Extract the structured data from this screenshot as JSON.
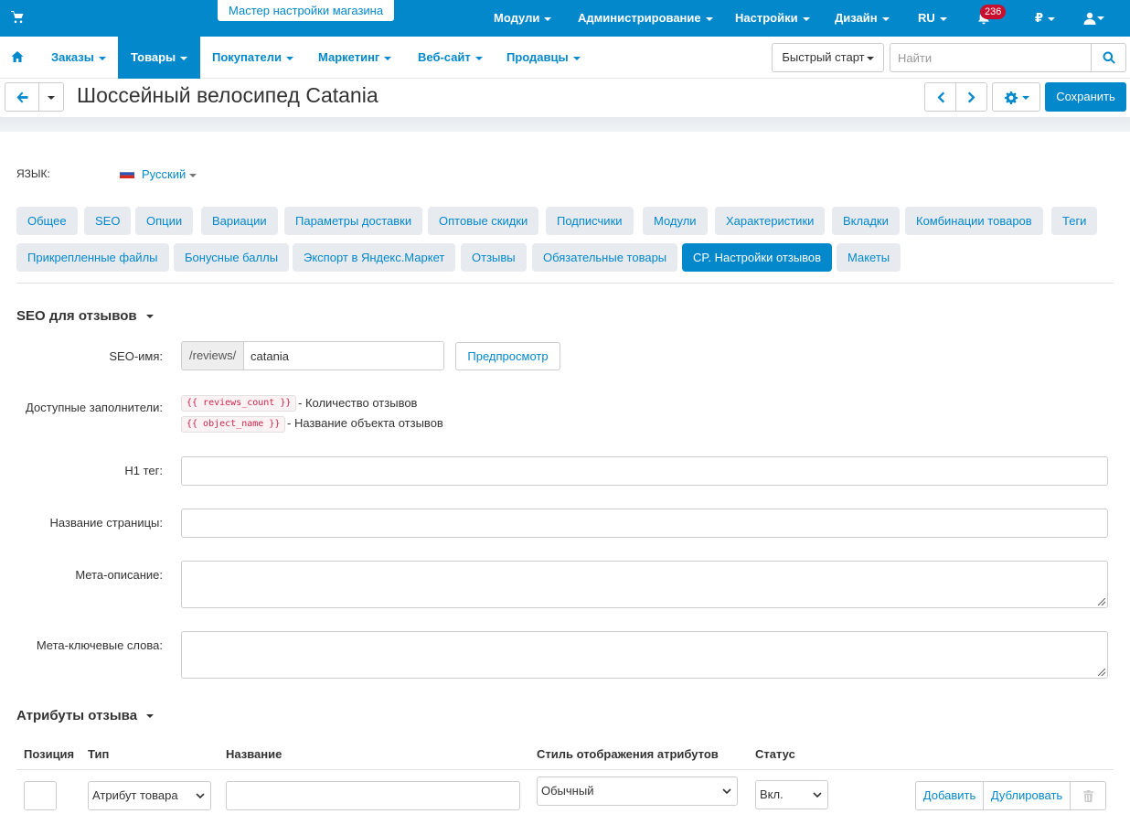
{
  "topbar": {
    "wizard_tab": "Мастер настройки магазина",
    "menu": [
      "Модули",
      "Администрирование",
      "Настройки",
      "Дизайн",
      "RU"
    ],
    "notifications_count": "236",
    "currency": "₽",
    "bg_color": "#0388cc"
  },
  "navbar": {
    "items": [
      "Заказы",
      "Товары",
      "Покупатели",
      "Маркетинг",
      "Веб-сайт",
      "Продавцы"
    ],
    "active": "Товары",
    "quick_start": "Быстрый старт",
    "search_placeholder": "Найти"
  },
  "titlebar": {
    "title": "Шоссейный велосипед Catania",
    "save_label": "Сохранить"
  },
  "language": {
    "label": "ЯЗЫК:",
    "value": "Русский"
  },
  "tabs": [
    "Общее",
    "SEO",
    "Опции",
    "Вариации",
    "Параметры доставки",
    "Оптовые скидки",
    "Подписчики",
    "Модули",
    "Характеристики",
    "Вкладки",
    "Комбинации товаров",
    "Теги",
    "Прикрепленные файлы",
    "Бонусные баллы",
    "Экспорт в Яндекс.Маркет",
    "Отзывы",
    "Обязательные товары",
    "CP. Настройки отзывов",
    "Макеты"
  ],
  "active_tab": "CP. Настройки отзывов",
  "seo_section": {
    "title": "SEO для отзывов",
    "seo_name_label": "SEO-имя:",
    "seo_prefix": "/reviews/",
    "seo_name_value": "catania",
    "preview_label": "Предпросмотр",
    "placeholders_label": "Доступные заполнители:",
    "placeholders": [
      {
        "code": "{{ reviews_count }}",
        "desc": "- Количество отзывов"
      },
      {
        "code": "{{ object_name }}",
        "desc": "- Название объекта отзывов"
      }
    ],
    "h1_label": "H1 тег:",
    "page_title_label": "Название страницы:",
    "meta_desc_label": "Мета-описание:",
    "meta_keywords_label": "Мета-ключевые слова:"
  },
  "attributes_section": {
    "title": "Атрибуты отзыва",
    "columns": [
      "Позиция",
      "Тип",
      "Название",
      "Стиль отображения атрибутов",
      "Статус"
    ],
    "row": {
      "type": "Атрибут товара",
      "style": "Обычный",
      "status": "Вкл.",
      "add_label": "Добавить",
      "duplicate_label": "Дублировать"
    }
  }
}
